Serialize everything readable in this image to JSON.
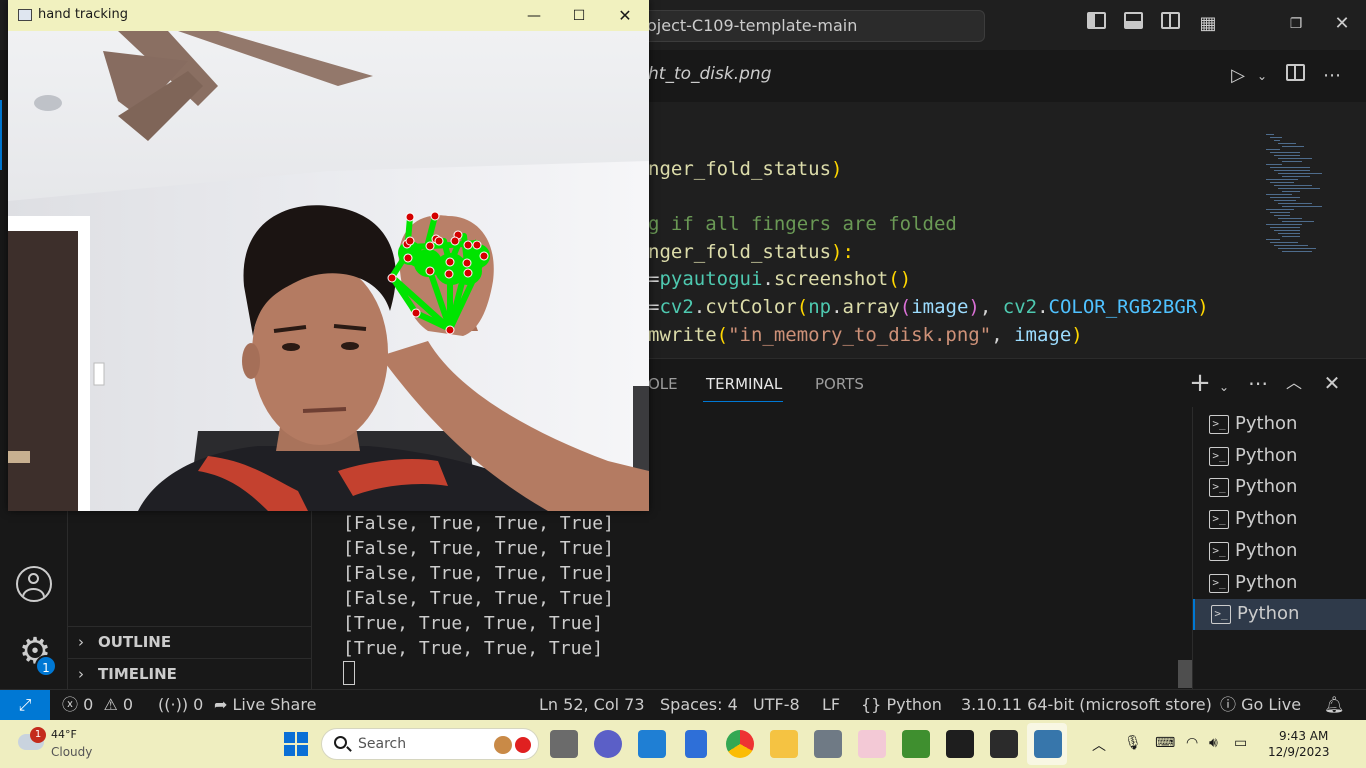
{
  "vscode": {
    "title": "oject-C109-template-main",
    "tab_title": "ht_to_disk.png",
    "code_lines": [
      [
        {
          "t": "nger_fold_status",
          "c": "#dcdcaa"
        },
        {
          "t": ")",
          "c": "#ffd700"
        }
      ],
      [],
      [
        {
          "t": "g if all fingers are folded",
          "c": "#6a9955"
        }
      ],
      [
        {
          "t": "nger_fold_status",
          "c": "#dcdcaa"
        },
        {
          "t": "):",
          "c": "#ffd700"
        }
      ],
      [
        {
          "t": "=",
          "c": "#d4d4d4"
        },
        {
          "t": "pyautogui",
          "c": "#4ec9b0"
        },
        {
          "t": ".",
          "c": "#d4d4d4"
        },
        {
          "t": "screenshot",
          "c": "#dcdcaa"
        },
        {
          "t": "()",
          "c": "#ffd700"
        }
      ],
      [
        {
          "t": "=",
          "c": "#d4d4d4"
        },
        {
          "t": "cv2",
          "c": "#4ec9b0"
        },
        {
          "t": ".",
          "c": "#d4d4d4"
        },
        {
          "t": "cvtColor",
          "c": "#dcdcaa"
        },
        {
          "t": "(",
          "c": "#ffd700"
        },
        {
          "t": "np",
          "c": "#4ec9b0"
        },
        {
          "t": ".",
          "c": "#d4d4d4"
        },
        {
          "t": "array",
          "c": "#dcdcaa"
        },
        {
          "t": "(",
          "c": "#da70d6"
        },
        {
          "t": "image",
          "c": "#9cdcfe"
        },
        {
          "t": ")",
          "c": "#da70d6"
        },
        {
          "t": ", ",
          "c": "#d4d4d4"
        },
        {
          "t": "cv2",
          "c": "#4ec9b0"
        },
        {
          "t": ".",
          "c": "#d4d4d4"
        },
        {
          "t": "COLOR_RGB2BGR",
          "c": "#4fc1ff"
        },
        {
          "t": ")",
          "c": "#ffd700"
        }
      ],
      [
        {
          "t": "mwrite",
          "c": "#dcdcaa"
        },
        {
          "t": "(",
          "c": "#ffd700"
        },
        {
          "t": "\"in_memory_to_disk.png\"",
          "c": "#ce9178"
        },
        {
          "t": ", ",
          "c": "#d4d4d4"
        },
        {
          "t": "image",
          "c": "#9cdcfe"
        },
        {
          "t": ")",
          "c": "#ffd700"
        }
      ]
    ],
    "panel_tabs": {
      "console": "OLE",
      "terminal": "TERMINAL",
      "ports": "PORTS"
    },
    "terminal_lines": [
      "[False, True, True, True]",
      "[False, True, True, True]",
      "[False, True, True, True]",
      "[False, True, True, True]",
      "[True, True, True, True]",
      "[True, True, True, True]"
    ],
    "terminals": [
      "Python",
      "Python",
      "Python",
      "Python",
      "Python",
      "Python",
      "Python"
    ],
    "sidebar": {
      "outline": "OUTLINE",
      "timeline": "TIMELINE"
    },
    "settings_badge": "1",
    "status": {
      "errors": "0",
      "warnings": "0",
      "ports": "0",
      "live_share": "Live Share",
      "position": "Ln 52, Col 73",
      "spaces": "Spaces: 4",
      "encoding": "UTF-8",
      "eol": "LF",
      "language": "Python",
      "interpreter": "3.10.11 64-bit (microsoft store)",
      "go_live": "Go Live"
    }
  },
  "cv_window": {
    "title": "hand tracking"
  },
  "taskbar": {
    "weather_badge": "1",
    "temp": "44°F",
    "condition": "Cloudy",
    "search_placeholder": "Search",
    "time": "9:43 AM",
    "date": "12/9/2023"
  },
  "colors": {
    "accent": "#0078d4",
    "taskbar_bg": "#efeec0",
    "landmark_line": "#00e400",
    "landmark_point": "#d40000"
  }
}
